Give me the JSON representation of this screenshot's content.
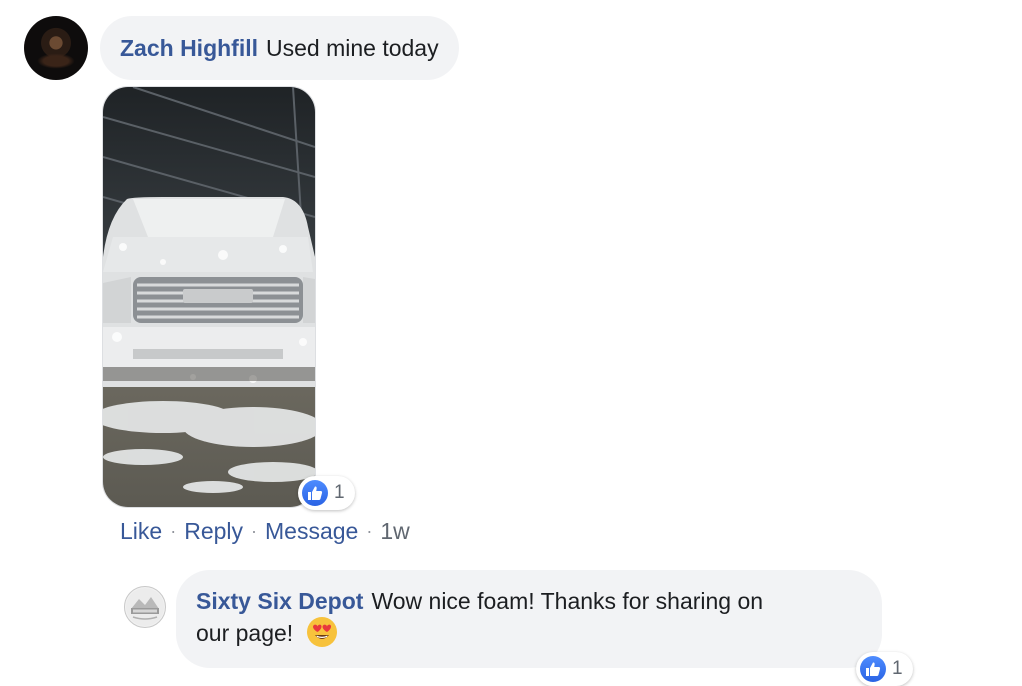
{
  "comment": {
    "author": "Zach Highfill",
    "text": "Used mine today",
    "photo_icon": "foamed-pickup-truck-photo",
    "reaction": {
      "icon": "like-icon",
      "count": "1"
    },
    "actions": {
      "like": "Like",
      "reply": "Reply",
      "message": "Message",
      "separator": "·",
      "time": "1w"
    }
  },
  "reply": {
    "author": "Sixty Six Depot",
    "text_line1": "Wow nice foam! Thanks for sharing on",
    "text_line2": "our page!",
    "emoji_icon": "heart-eyes-emoji-icon",
    "reaction": {
      "icon": "like-icon",
      "count": "1"
    }
  },
  "colors": {
    "link": "#385898",
    "bubble": "#f2f3f5",
    "like_blue": "#2a63e4"
  }
}
